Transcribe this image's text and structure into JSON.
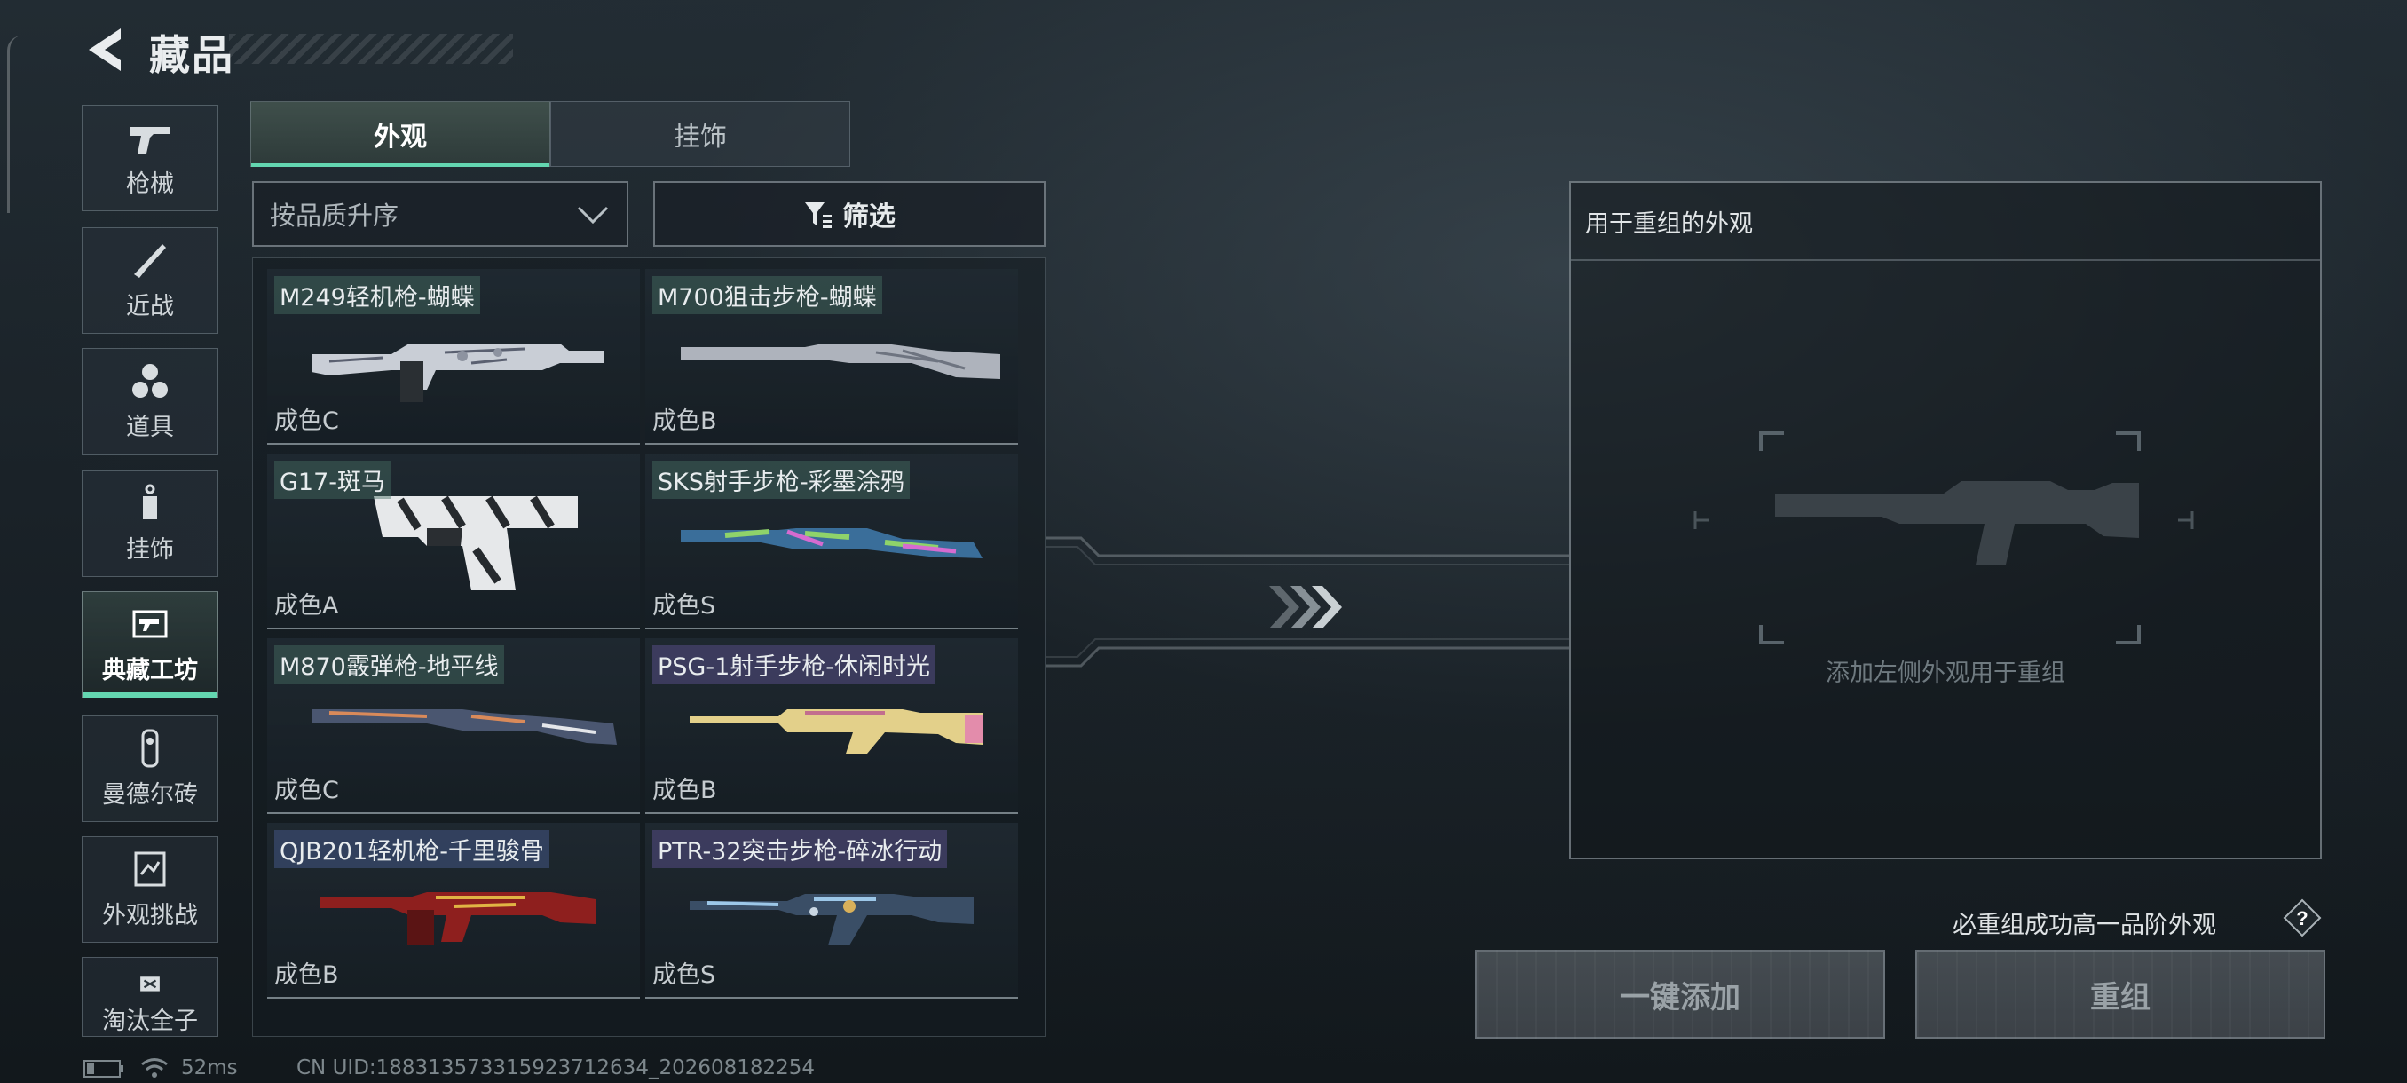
{
  "header": {
    "title": "藏品"
  },
  "sidebar": {
    "items": [
      {
        "label": "枪械",
        "icon": "pistol-icon"
      },
      {
        "label": "近战",
        "icon": "knife-icon"
      },
      {
        "label": "道具",
        "icon": "grenades-icon"
      },
      {
        "label": "挂饰",
        "icon": "pendant-icon"
      },
      {
        "label": "典藏工坊",
        "icon": "workshop-icon",
        "active": true
      },
      {
        "label": "曼德尔砖",
        "icon": "brick-icon"
      },
      {
        "label": "外观挑战",
        "icon": "challenge-icon"
      },
      {
        "label": "淘汰全子",
        "icon": "elimination-icon"
      }
    ]
  },
  "tabs": [
    {
      "label": "外观",
      "active": true
    },
    {
      "label": "挂饰",
      "active": false
    }
  ],
  "sort": {
    "label": "按品质升序"
  },
  "filter": {
    "label": "筛选"
  },
  "items": [
    {
      "name": "M249轻机枪-蝴蝶",
      "grade": "成色C"
    },
    {
      "name": "M700狙击步枪-蝴蝶",
      "grade": "成色B"
    },
    {
      "name": "G17-斑马",
      "grade": "成色A"
    },
    {
      "name": "SKS射手步枪-彩墨涂鸦",
      "grade": "成色S"
    },
    {
      "name": "M870霰弹枪-地平线",
      "grade": "成色C"
    },
    {
      "name": "PSG-1射手步枪-休闲时光",
      "grade": "成色B"
    },
    {
      "name": "QJB201轻机枪-千里骏骨",
      "grade": "成色B"
    },
    {
      "name": "PTR-32突击步枪-碎冰行动",
      "grade": "成色S"
    }
  ],
  "recombine_panel": {
    "title": "用于重组的外观",
    "placeholder": "添加左侧外观用于重组"
  },
  "guarantee_text": "必重组成功高一品阶外观",
  "buttons": {
    "add_all": "一键添加",
    "recombine": "重组"
  },
  "status_bar": {
    "ping": "52ms",
    "uid": "CN UID:1883135733159237126​34_202608182254"
  },
  "colors": {
    "accent": "#63d6b0",
    "background": "#1a2228"
  }
}
